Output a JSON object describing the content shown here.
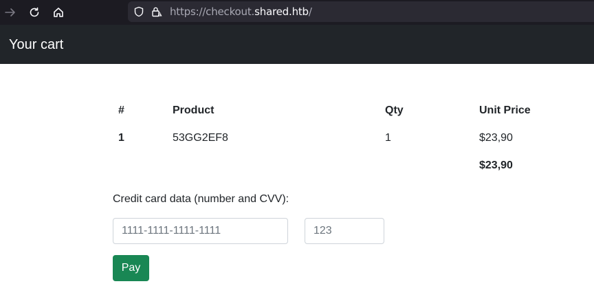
{
  "browser": {
    "url_scheme": "https://",
    "url_subdomain": "checkout.",
    "url_host": "shared.htb",
    "url_path": "/",
    "icons": [
      "back-arrow-icon",
      "reload-icon",
      "home-icon",
      "shield-icon",
      "lock-warning-icon"
    ]
  },
  "header": {
    "title": "Your cart"
  },
  "cart": {
    "columns": {
      "num": "#",
      "product": "Product",
      "qty": "Qty",
      "unit_price": "Unit Price"
    },
    "rows": [
      {
        "num": "1",
        "product": "53GG2EF8",
        "qty": "1",
        "unit_price": "$23,90"
      }
    ],
    "total": "$23,90"
  },
  "payment": {
    "label": "Credit card data (number and CVV):",
    "card_placeholder": "1111-1111-1111-1111",
    "cvv_placeholder": "123",
    "pay_label": "Pay",
    "pay_color": "#198754"
  }
}
